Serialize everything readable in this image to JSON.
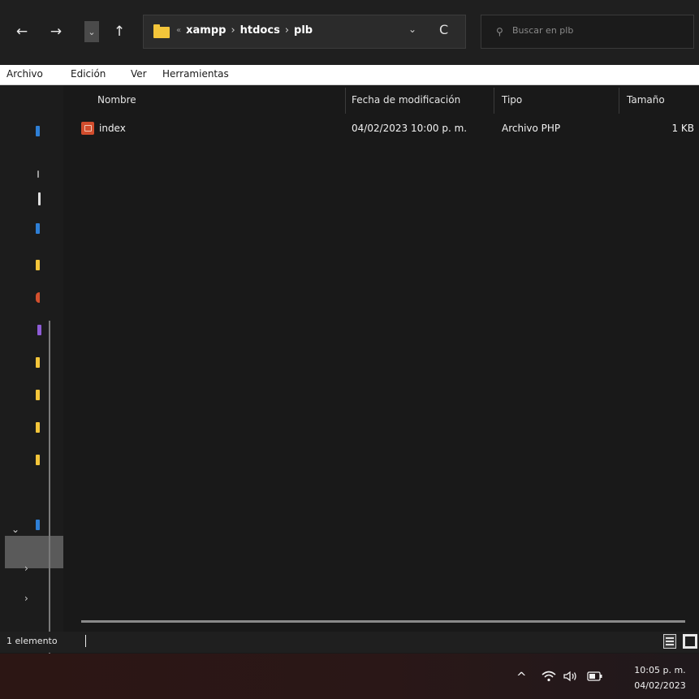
{
  "address_bar": {
    "back_icon": "←",
    "forward_icon": "→",
    "recent_icon": "⌄",
    "up_icon": "↑",
    "overflow": "«",
    "crumbs": [
      "xampp",
      "htdocs",
      "plb"
    ],
    "separator": "›",
    "dropdown_icon": "⌄",
    "refresh_icon": "C"
  },
  "search": {
    "icon": "⚲",
    "placeholder": "Buscar en plb"
  },
  "menu": [
    "Archivo",
    "Edición",
    "Ver",
    "Herramientas"
  ],
  "columns": {
    "name": "Nombre",
    "date": "Fecha de modificación",
    "type": "Tipo",
    "size": "Tamaño"
  },
  "files": [
    {
      "name": "index",
      "date": "04/02/2023 10:00 p. m.",
      "type": "Archivo PHP",
      "size": "1 KB",
      "icon": "php-file-icon"
    }
  ],
  "nav_pane": {
    "expanded_arrow": "⌄",
    "collapsed_arrow_1": "›",
    "collapsed_arrow_2": "›",
    "colors": [
      "#2e7fd6",
      "#9a9a9a",
      "#e0e0e0",
      "#2e7fd6",
      "#f3c53a",
      "#d4502e",
      "#8e5cd6",
      "#f3c53a",
      "#f3c53a",
      "#f3c53a",
      "#f3c53a",
      "#2e7fd6"
    ]
  },
  "status": {
    "count": "1 elemento"
  },
  "taskbar": {
    "chevron_icon": "^",
    "wifi_icon": "wifi",
    "volume_icon": "volume",
    "battery_icon": "battery",
    "time": "10:05 p. m.",
    "date": "04/02/2023"
  }
}
